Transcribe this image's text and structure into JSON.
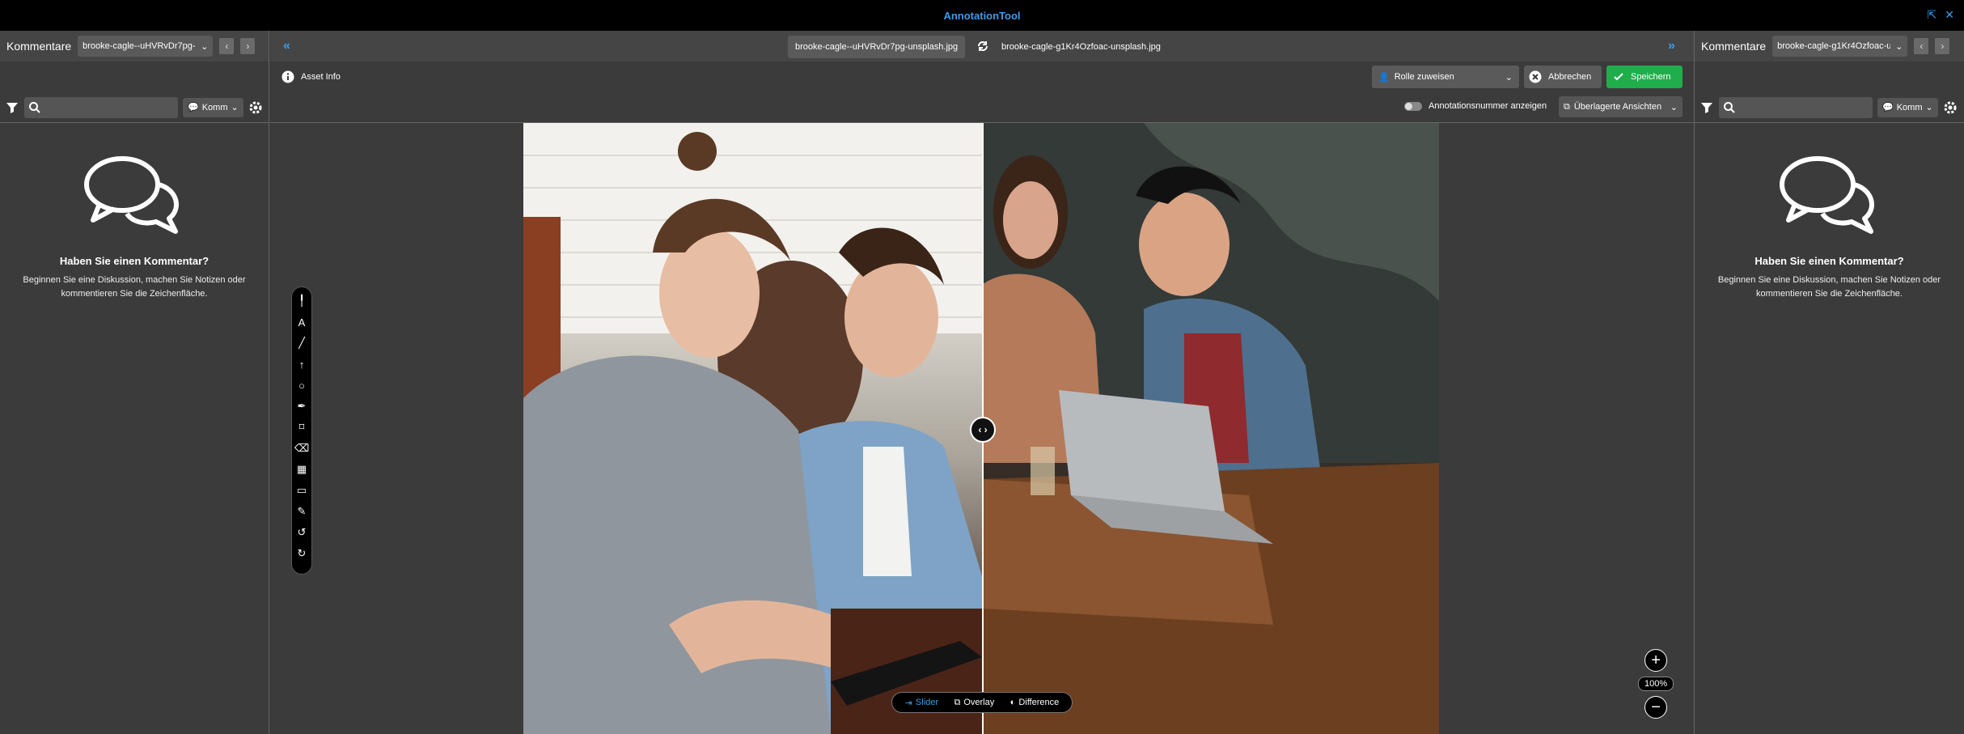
{
  "app": {
    "title": "AnnotationTool"
  },
  "left_panel": {
    "title": "Kommentare",
    "file_select": "brooke-cagle--uHVRvDr7pg-unsplash.jpg",
    "kommentar_filter": "Komm",
    "empty_title": "Haben Sie einen Kommentar?",
    "empty_line1": "Beginnen Sie eine Diskussion, machen Sie Notizen oder",
    "empty_line2": "kommentieren Sie die Zeichenfläche."
  },
  "right_panel": {
    "title": "Kommentare",
    "file_select": "brooke-cagle-g1Kr4Ozfoac-unsplash.jpg",
    "kommentar_filter": "Komm",
    "empty_title": "Haben Sie einen Kommentar?",
    "empty_line1": "Beginnen Sie eine Diskussion, machen Sie Notizen oder",
    "empty_line2": "kommentieren Sie die Zeichenfläche."
  },
  "center": {
    "tab_left": "brooke-cagle--uHVRvDr7pg-unsplash.jpg",
    "tab_right": "brooke-cagle-g1Kr4Ozfoac-unsplash.jpg",
    "asset_info": "Asset Info",
    "role_select": "Rolle zuweisen",
    "cancel": "Abbrechen",
    "save": "Speichern",
    "toggle_label": "Annotationsnummer anzeigen",
    "overlay_select": "Überlagerte Ansichten"
  },
  "compare_modes": {
    "slider": "Slider",
    "overlay": "Overlay",
    "difference": "Difference"
  },
  "zoom": {
    "level": "100%"
  },
  "colors": {
    "accent": "#3d9be9",
    "save": "#1fae4b",
    "bg": "#3b3b3b",
    "bar": "#000000"
  }
}
